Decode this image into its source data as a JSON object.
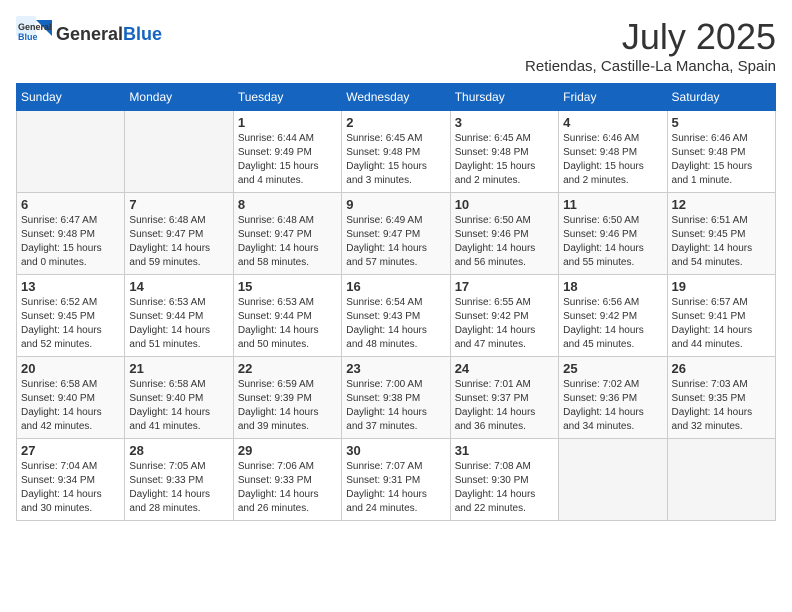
{
  "logo": {
    "text1": "General",
    "text2": "Blue"
  },
  "title": "July 2025",
  "location": "Retiendas, Castille-La Mancha, Spain",
  "weekdays": [
    "Sunday",
    "Monday",
    "Tuesday",
    "Wednesday",
    "Thursday",
    "Friday",
    "Saturday"
  ],
  "weeks": [
    [
      {
        "day": "",
        "info": ""
      },
      {
        "day": "",
        "info": ""
      },
      {
        "day": "1",
        "info": "Sunrise: 6:44 AM\nSunset: 9:49 PM\nDaylight: 15 hours and 4 minutes."
      },
      {
        "day": "2",
        "info": "Sunrise: 6:45 AM\nSunset: 9:48 PM\nDaylight: 15 hours and 3 minutes."
      },
      {
        "day": "3",
        "info": "Sunrise: 6:45 AM\nSunset: 9:48 PM\nDaylight: 15 hours and 2 minutes."
      },
      {
        "day": "4",
        "info": "Sunrise: 6:46 AM\nSunset: 9:48 PM\nDaylight: 15 hours and 2 minutes."
      },
      {
        "day": "5",
        "info": "Sunrise: 6:46 AM\nSunset: 9:48 PM\nDaylight: 15 hours and 1 minute."
      }
    ],
    [
      {
        "day": "6",
        "info": "Sunrise: 6:47 AM\nSunset: 9:48 PM\nDaylight: 15 hours and 0 minutes."
      },
      {
        "day": "7",
        "info": "Sunrise: 6:48 AM\nSunset: 9:47 PM\nDaylight: 14 hours and 59 minutes."
      },
      {
        "day": "8",
        "info": "Sunrise: 6:48 AM\nSunset: 9:47 PM\nDaylight: 14 hours and 58 minutes."
      },
      {
        "day": "9",
        "info": "Sunrise: 6:49 AM\nSunset: 9:47 PM\nDaylight: 14 hours and 57 minutes."
      },
      {
        "day": "10",
        "info": "Sunrise: 6:50 AM\nSunset: 9:46 PM\nDaylight: 14 hours and 56 minutes."
      },
      {
        "day": "11",
        "info": "Sunrise: 6:50 AM\nSunset: 9:46 PM\nDaylight: 14 hours and 55 minutes."
      },
      {
        "day": "12",
        "info": "Sunrise: 6:51 AM\nSunset: 9:45 PM\nDaylight: 14 hours and 54 minutes."
      }
    ],
    [
      {
        "day": "13",
        "info": "Sunrise: 6:52 AM\nSunset: 9:45 PM\nDaylight: 14 hours and 52 minutes."
      },
      {
        "day": "14",
        "info": "Sunrise: 6:53 AM\nSunset: 9:44 PM\nDaylight: 14 hours and 51 minutes."
      },
      {
        "day": "15",
        "info": "Sunrise: 6:53 AM\nSunset: 9:44 PM\nDaylight: 14 hours and 50 minutes."
      },
      {
        "day": "16",
        "info": "Sunrise: 6:54 AM\nSunset: 9:43 PM\nDaylight: 14 hours and 48 minutes."
      },
      {
        "day": "17",
        "info": "Sunrise: 6:55 AM\nSunset: 9:42 PM\nDaylight: 14 hours and 47 minutes."
      },
      {
        "day": "18",
        "info": "Sunrise: 6:56 AM\nSunset: 9:42 PM\nDaylight: 14 hours and 45 minutes."
      },
      {
        "day": "19",
        "info": "Sunrise: 6:57 AM\nSunset: 9:41 PM\nDaylight: 14 hours and 44 minutes."
      }
    ],
    [
      {
        "day": "20",
        "info": "Sunrise: 6:58 AM\nSunset: 9:40 PM\nDaylight: 14 hours and 42 minutes."
      },
      {
        "day": "21",
        "info": "Sunrise: 6:58 AM\nSunset: 9:40 PM\nDaylight: 14 hours and 41 minutes."
      },
      {
        "day": "22",
        "info": "Sunrise: 6:59 AM\nSunset: 9:39 PM\nDaylight: 14 hours and 39 minutes."
      },
      {
        "day": "23",
        "info": "Sunrise: 7:00 AM\nSunset: 9:38 PM\nDaylight: 14 hours and 37 minutes."
      },
      {
        "day": "24",
        "info": "Sunrise: 7:01 AM\nSunset: 9:37 PM\nDaylight: 14 hours and 36 minutes."
      },
      {
        "day": "25",
        "info": "Sunrise: 7:02 AM\nSunset: 9:36 PM\nDaylight: 14 hours and 34 minutes."
      },
      {
        "day": "26",
        "info": "Sunrise: 7:03 AM\nSunset: 9:35 PM\nDaylight: 14 hours and 32 minutes."
      }
    ],
    [
      {
        "day": "27",
        "info": "Sunrise: 7:04 AM\nSunset: 9:34 PM\nDaylight: 14 hours and 30 minutes."
      },
      {
        "day": "28",
        "info": "Sunrise: 7:05 AM\nSunset: 9:33 PM\nDaylight: 14 hours and 28 minutes."
      },
      {
        "day": "29",
        "info": "Sunrise: 7:06 AM\nSunset: 9:33 PM\nDaylight: 14 hours and 26 minutes."
      },
      {
        "day": "30",
        "info": "Sunrise: 7:07 AM\nSunset: 9:31 PM\nDaylight: 14 hours and 24 minutes."
      },
      {
        "day": "31",
        "info": "Sunrise: 7:08 AM\nSunset: 9:30 PM\nDaylight: 14 hours and 22 minutes."
      },
      {
        "day": "",
        "info": ""
      },
      {
        "day": "",
        "info": ""
      }
    ]
  ]
}
